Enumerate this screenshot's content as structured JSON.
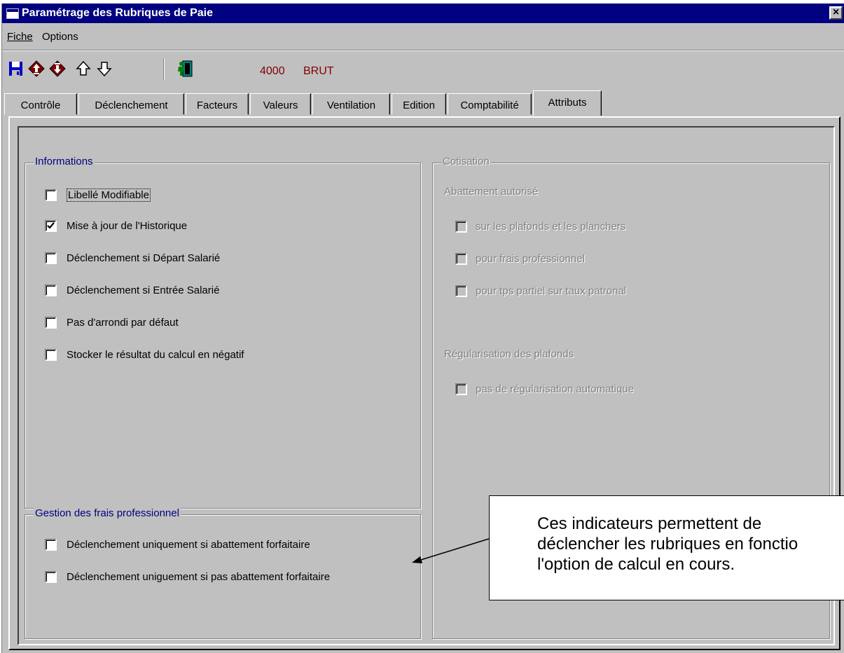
{
  "window": {
    "title": "Paramétrage des Rubriques de Paie",
    "close_label": "×"
  },
  "menu": [
    {
      "label": "Fiche"
    },
    {
      "label": "Options"
    }
  ],
  "toolbar": {
    "buttons": [
      {
        "icon": "save-icon"
      },
      {
        "icon": "first-record-icon"
      },
      {
        "icon": "last-record-icon"
      },
      {
        "icon": "arrow-up-icon"
      },
      {
        "icon": "arrow-down-icon"
      },
      {
        "icon": "exit-icon"
      }
    ],
    "code": "4000",
    "code_label": "BRUT"
  },
  "tabs": [
    {
      "label": "Contrôle"
    },
    {
      "label": "Déclenchement"
    },
    {
      "label": "Facteurs"
    },
    {
      "label": "Valeurs"
    },
    {
      "label": "Ventilation"
    },
    {
      "label": "Edition"
    },
    {
      "label": "Comptabilité"
    },
    {
      "label": "Attributs",
      "active": true
    }
  ],
  "informations": {
    "title": "Informations",
    "options": [
      {
        "label": "Libellé Modifiable",
        "checked": false
      },
      {
        "label": "Mise à jour de l'Historique",
        "checked": true
      },
      {
        "label": "Déclenchement si Départ Salarié",
        "checked": false
      },
      {
        "label": "Déclenchement si Entrée Salarié",
        "checked": false
      },
      {
        "label": "Pas d'arrondi par défaut",
        "checked": false
      },
      {
        "label": "Stocker le résultat du calcul en négatif",
        "checked": false
      }
    ]
  },
  "frais": {
    "title": "Gestion des frais professionnel",
    "options": [
      {
        "label": "Déclenchement uniquement si abattement forfaitaire",
        "checked": false
      },
      {
        "label": "Déclenchement uniguement si  pas abattement forfaitaire",
        "checked": false
      }
    ]
  },
  "cotisation": {
    "title": "Cotisation",
    "abattement_label": "Abattement autorisé",
    "abattement_options": [
      {
        "label": "sur les plafonds et les planchers",
        "checked": false
      },
      {
        "label": "pour frais professionnel",
        "checked": false
      },
      {
        "label": "pour tps partiel sur taux patronal",
        "checked": false
      }
    ],
    "regularisation_label": "Régularisation des plafonds",
    "regularisation_options": [
      {
        "label": "pas de régularisation automatique",
        "checked": false
      }
    ]
  },
  "callout": {
    "text": "Ces indicateurs permettent de\ndéclencher les rubriques en fonctio\nl'option de calcul en cours."
  },
  "colors": {
    "titlebar": "#000080",
    "face": "#c0c0c0",
    "code": "#800000",
    "disabled": "#808080"
  }
}
